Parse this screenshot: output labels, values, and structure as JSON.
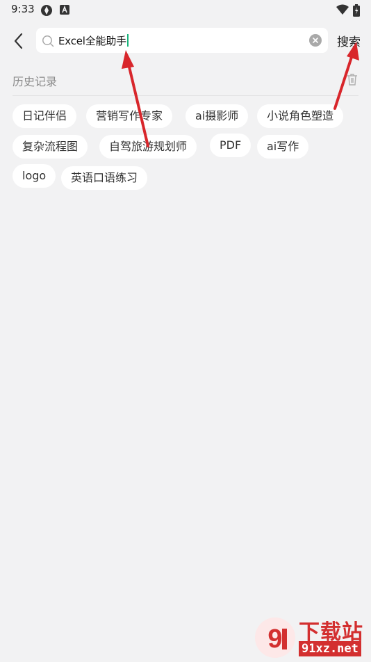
{
  "status_bar": {
    "time": "9:33",
    "icons": [
      "sync-icon",
      "keyboard-a-icon",
      "wifi-icon",
      "battery-icon"
    ]
  },
  "header": {
    "back_icon": "chevron-left-icon",
    "search": {
      "value": "Excel全能助手",
      "icon": "magnifier-icon",
      "clear_icon": "clear-circle-icon",
      "caret_color": "#18b57c"
    },
    "search_button_label": "搜索"
  },
  "history": {
    "title": "历史记录",
    "delete_icon": "trash-icon",
    "items": [
      "日记伴侣",
      "营销写作专家",
      "ai摄影师",
      "小说角色塑造",
      "复杂流程图",
      "自驾旅游规划师",
      "PDF",
      "ai写作",
      "logo",
      "英语口语练习"
    ]
  },
  "watermark": {
    "logo_icon": "91-logo-icon",
    "text": "下载站",
    "url": "91xz.net",
    "color": "#d32f2f"
  },
  "annotation_color": "#d8262b"
}
